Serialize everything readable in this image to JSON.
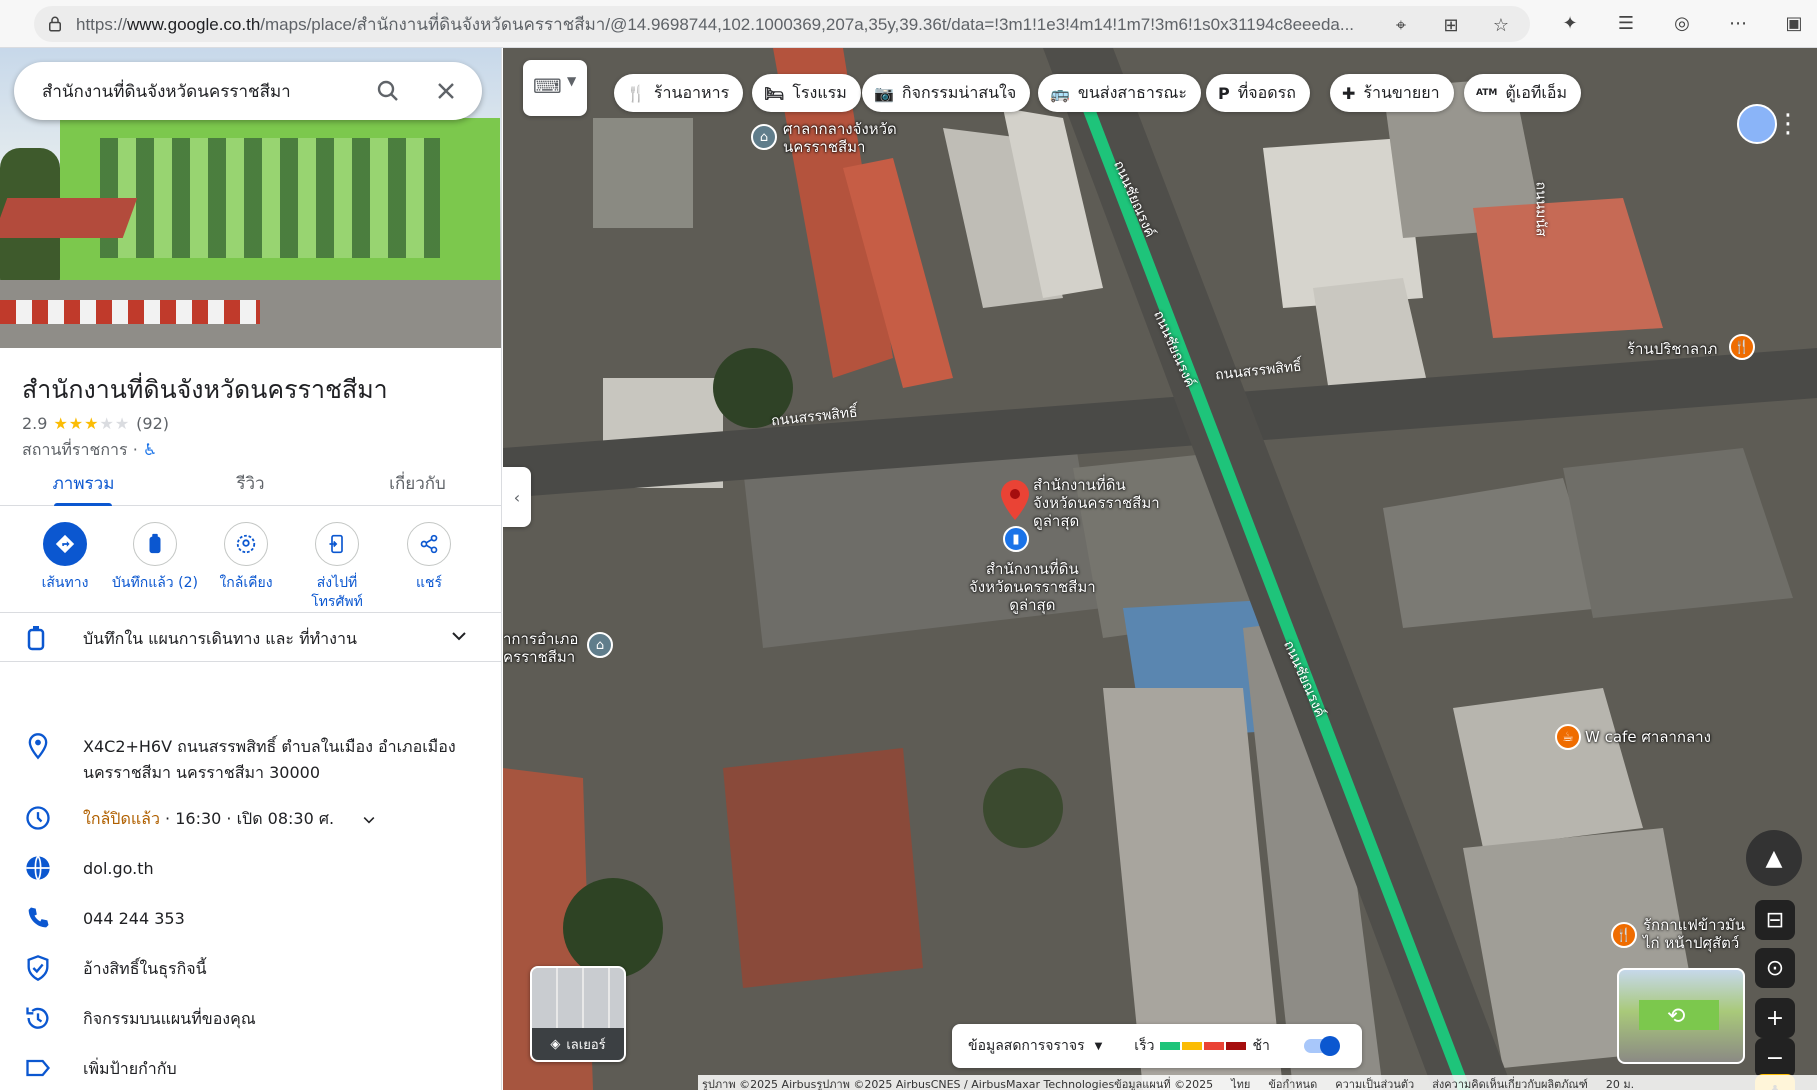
{
  "browser": {
    "url_prefix": "https://",
    "url_domain": "www.google.co.th",
    "url_rest": "/maps/place/สำนักงานที่ดินจังหวัดนครราชสีมา/@14.9698744,102.1000369,207a,35y,39.36t/data=!3m1!1e3!4m14!1m7!3m6!1s0x31194c8eeeda..."
  },
  "search": {
    "query": "สำนักงานที่ดินจังหวัดนครราชสีมา"
  },
  "place": {
    "name": "สำนักงานที่ดินจังหวัดนครราชสีมา",
    "rating": "2.9",
    "stars": 3,
    "review_count": "(92)",
    "category": "สถานที่ราชการ ·",
    "accessible_icon": "♿"
  },
  "tabs": [
    "ภาพรวม",
    "รีวิว",
    "เกี่ยวกับ"
  ],
  "actions": [
    {
      "label": "เส้นทาง",
      "icon": "directions-icon"
    },
    {
      "label": "บันทึกแล้ว (2)",
      "icon": "bookmark-icon"
    },
    {
      "label": "ใกล้เคียง",
      "icon": "nearby-icon"
    },
    {
      "label": "ส่งไปที่ โทรศัพท์",
      "icon": "send-to-phone-icon"
    },
    {
      "label": "แชร์",
      "icon": "share-icon"
    }
  ],
  "saved_in": "บันทึกใน แผนการเดินทาง และ ที่ทำงาน",
  "info": {
    "address": "X4C2+H6V ถนนสรรพสิทธิ์ ตำบลในเมือง อำเภอเมืองนครราชสีมา นครราชสีมา 30000",
    "hours_status": "ใกล้ปิดแล้ว",
    "hours_detail": " · 16:30 · เปิด 08:30 ศ.",
    "website": "dol.go.th",
    "phone": "044 244 353",
    "claim": "อ้างสิทธิ์ในธุรกิจนี้",
    "activity": "กิจกรรมบนแผนที่ของคุณ",
    "label": "เพิ่มป้ายกำกับ"
  },
  "chips": [
    {
      "label": "ร้านอาหาร",
      "icon": "🍴"
    },
    {
      "label": "โรงแรม",
      "icon": "🛏"
    },
    {
      "label": "กิจกรรมน่าสนใจ",
      "icon": "📷"
    },
    {
      "label": "ขนส่งสาธารณะ",
      "icon": "🚌"
    },
    {
      "label": "ที่จอดรถ",
      "icon": "P"
    },
    {
      "label": "ร้านขายยา",
      "icon": "✚"
    },
    {
      "label": "ตู้เอทีเอ็ม",
      "icon": "ATM"
    }
  ],
  "map_labels": {
    "city_hall_1": "ศาลากลางจังหวัด",
    "city_hall_2": "นครราชสีมา",
    "pin_1": "สำนักงานที่ดิน",
    "pin_2": "จังหวัดนครราชสีมา",
    "pin_3": "ดูล่าสุด",
    "pin_b1": "สำนักงานที่ดิน",
    "pin_b2": "จังหวัดนครราชสีมา",
    "pin_b3": "ดูล่าสุด",
    "district_1": "าการอำเภอ",
    "district_2": "ครราชสีมา",
    "shop_1": "ร้านปริชาลาภ",
    "cafe": "W cafe ศาลากลาง",
    "coffee_1": "รักกาแฟข้าวมัน",
    "coffee_2": "ไก่ หน้าปศุสัตว์",
    "road_1": "ถนนสรรพสิทธิ์",
    "road_2": "ถนนสรรพสิทธิ์",
    "road_3": "ถนนชัยณรงค์",
    "road_4": "ถนนชัยณรงค์",
    "road_5": "ถนนชัยณรงค์",
    "road_6": "ถนนมนัส"
  },
  "layers_label": "เลเยอร์",
  "traffic": {
    "label": "ข้อมูลสดการจราจร",
    "fast": "เร็ว",
    "slow": "ช้า"
  },
  "footer": [
    "รูปภาพ ©2025 Airbusรูปภาพ ©2025 AirbusCNES / AirbusMaxar Technologiesข้อมูลแผนที่ ©2025",
    "ไทย",
    "ข้อกำหนด",
    "ความเป็นส่วนตัว",
    "ส่งความคิดเห็นเกี่ยวกับผลิตภัณฑ์",
    "20 ม."
  ],
  "colors": {
    "accent": "#0b57d0",
    "pin": "#ea4335",
    "green_road": "#1ec47a"
  }
}
